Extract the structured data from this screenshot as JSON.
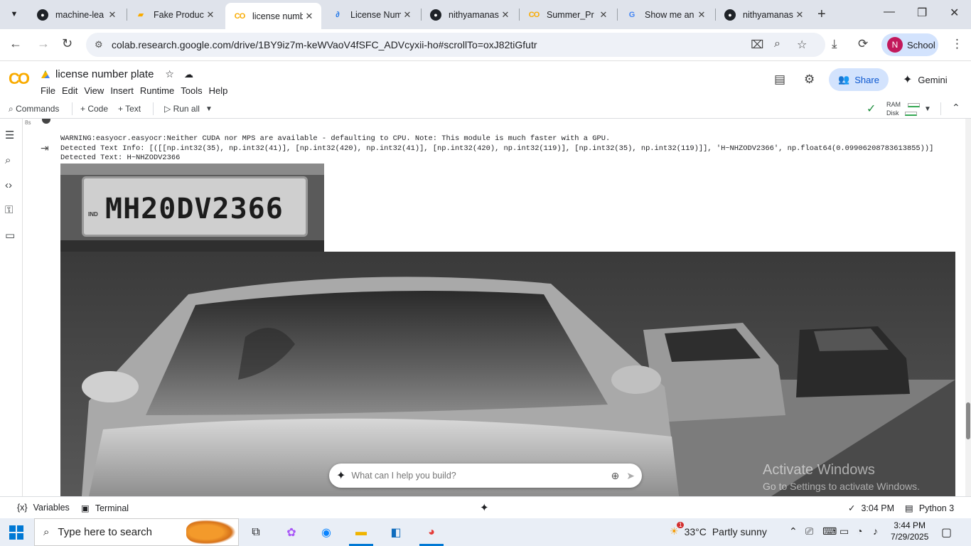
{
  "browser": {
    "tabs": [
      {
        "title": "machine-lea",
        "icon": "github-icon"
      },
      {
        "title": "Fake Product",
        "icon": "document-icon"
      },
      {
        "title": "license numb",
        "icon": "colab-icon",
        "active": true
      },
      {
        "title": "License Num",
        "icon": "link-icon"
      },
      {
        "title": "nithyamanas",
        "icon": "github-icon"
      },
      {
        "title": "Summer_Pr",
        "icon": "colab-icon"
      },
      {
        "title": "Show me an",
        "icon": "google-icon"
      },
      {
        "title": "nithyamanas",
        "icon": "github-icon"
      }
    ],
    "url": "colab.research.google.com/drive/1BY9iz7m-keWVaoV4fSFC_ADVcyxii-ho#scrollTo=oxJ82tiGfutr",
    "profile_initial": "N",
    "profile_label": "School"
  },
  "colab": {
    "logo": "CO",
    "notebook_title": "license number plate",
    "menu": [
      "File",
      "Edit",
      "View",
      "Insert",
      "Runtime",
      "Tools",
      "Help"
    ],
    "share_label": "Share",
    "gemini_label": "Gemini",
    "toolbar": {
      "commands": "Commands",
      "code": "+ Code",
      "text": "+ Text",
      "run_all": "Run all",
      "ram": "RAM",
      "disk": "Disk"
    }
  },
  "cell": {
    "exec_label": "8s",
    "output_lines": [
      "WARNING:easyocr.easyocr:Neither CUDA nor MPS are available - defaulting to CPU. Note: This module is much faster with a GPU.",
      "Detected Text Info: [([[np.int32(35), np.int32(41)], [np.int32(420), np.int32(41)], [np.int32(420), np.int32(119)], [np.int32(35), np.int32(119)]], 'H~NHZODV2366', np.float64(0.09906208783613855))]",
      "Detected Text: H~NHZODV2366"
    ],
    "plate_text": "MH20DV2366",
    "plate_country": "IND"
  },
  "gemini_prompt": {
    "placeholder": "What can I help you build?"
  },
  "watermark": {
    "line1": "Activate Windows",
    "line2": "Go to Settings to activate Windows."
  },
  "statusbar": {
    "variables": "Variables",
    "terminal": "Terminal",
    "time": "3:04 PM",
    "runtime": "Python 3"
  },
  "taskbar": {
    "search_placeholder": "Type here to search",
    "weather_temp": "33°C",
    "weather_desc": "Partly sunny",
    "weather_badge": "1",
    "clock_time": "3:44 PM",
    "clock_date": "7/29/2025"
  }
}
